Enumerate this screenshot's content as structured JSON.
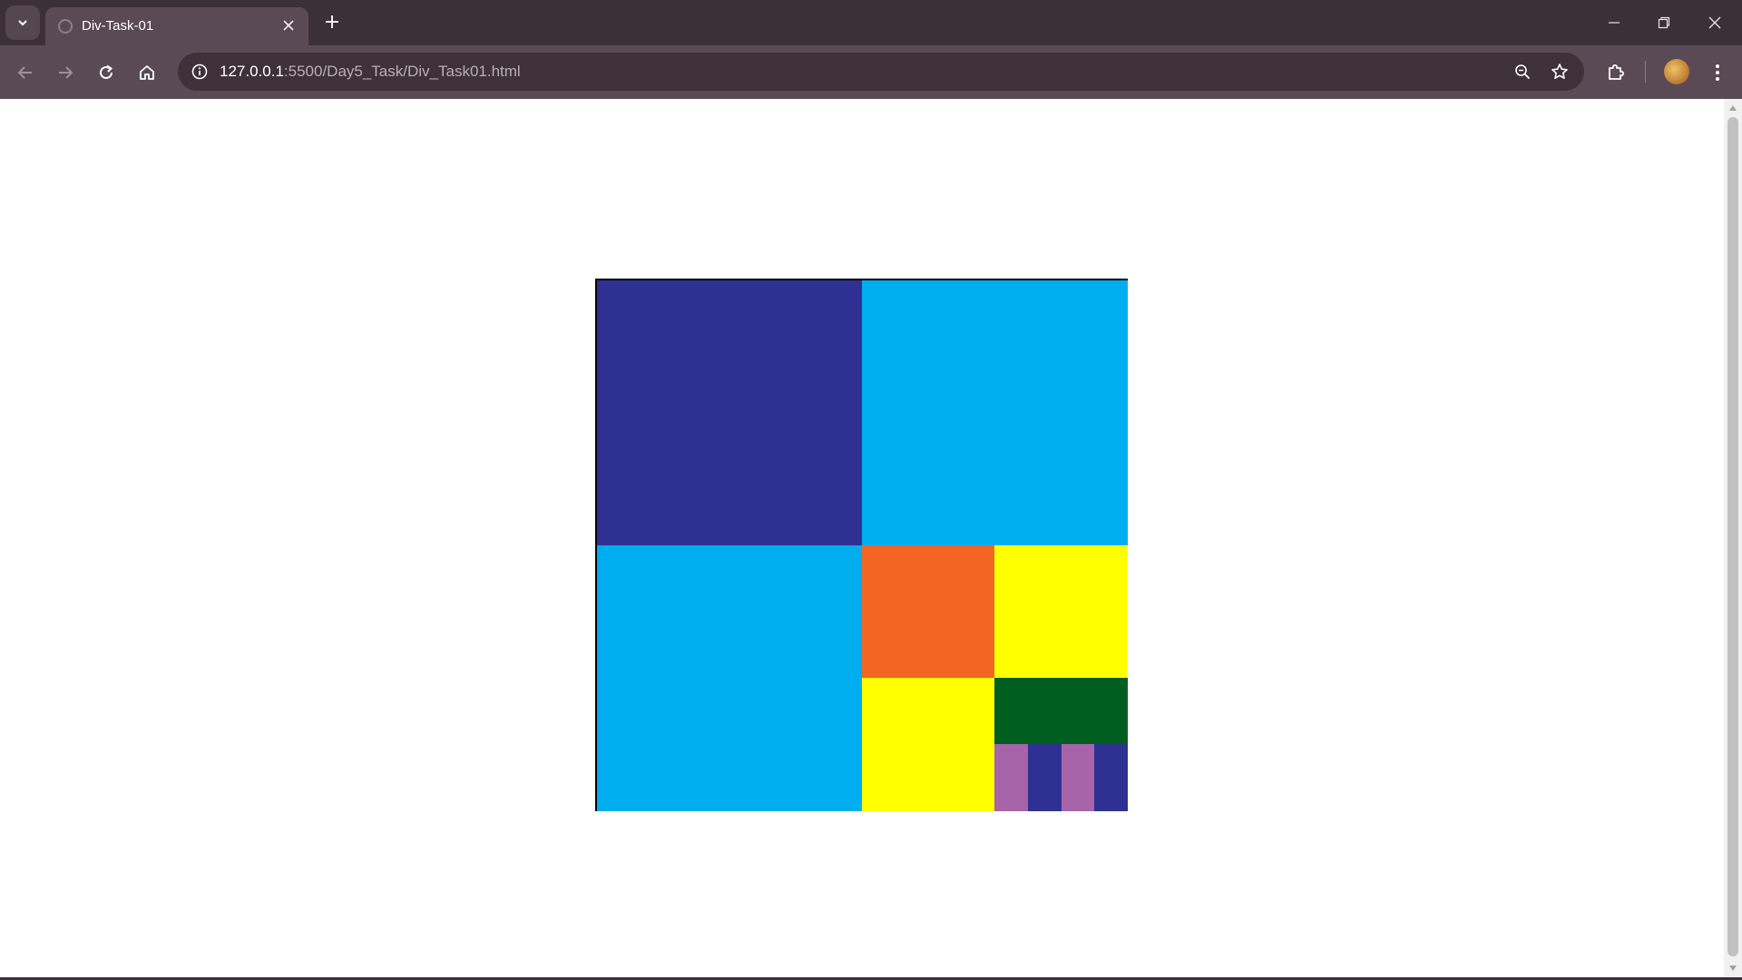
{
  "browser": {
    "tab": {
      "title": "Div-Task-01",
      "close_icon": "close-icon",
      "favicon": "globe-icon"
    },
    "new_tab_icon": "plus-icon",
    "window_controls": {
      "minimize": "minimize-icon",
      "restore": "restore-icon",
      "close": "close-icon"
    },
    "toolbar": {
      "back_icon": "arrow-left-icon",
      "forward_icon": "arrow-right-icon",
      "reload_icon": "reload-icon",
      "home_icon": "home-icon",
      "url_host": "127.0.0.1",
      "url_path": ":5500/Day5_Task/Div_Task01.html",
      "zoom_icon": "zoom-out-icon",
      "bookmark_icon": "star-icon",
      "extensions_icon": "puzzle-icon",
      "menu_icon": "kebab-menu-icon"
    },
    "colors": {
      "tabstrip": "#3c3038",
      "toolbar": "#5a4a55",
      "omnibox": "#3e3139"
    }
  },
  "page": {
    "colors": {
      "navy": "#2e3192",
      "cyan": "#00aeef",
      "orange": "#f26522",
      "yellow": "#ffff00",
      "green": "#005e20",
      "purple": "#a864a8",
      "border": "#000000"
    }
  }
}
